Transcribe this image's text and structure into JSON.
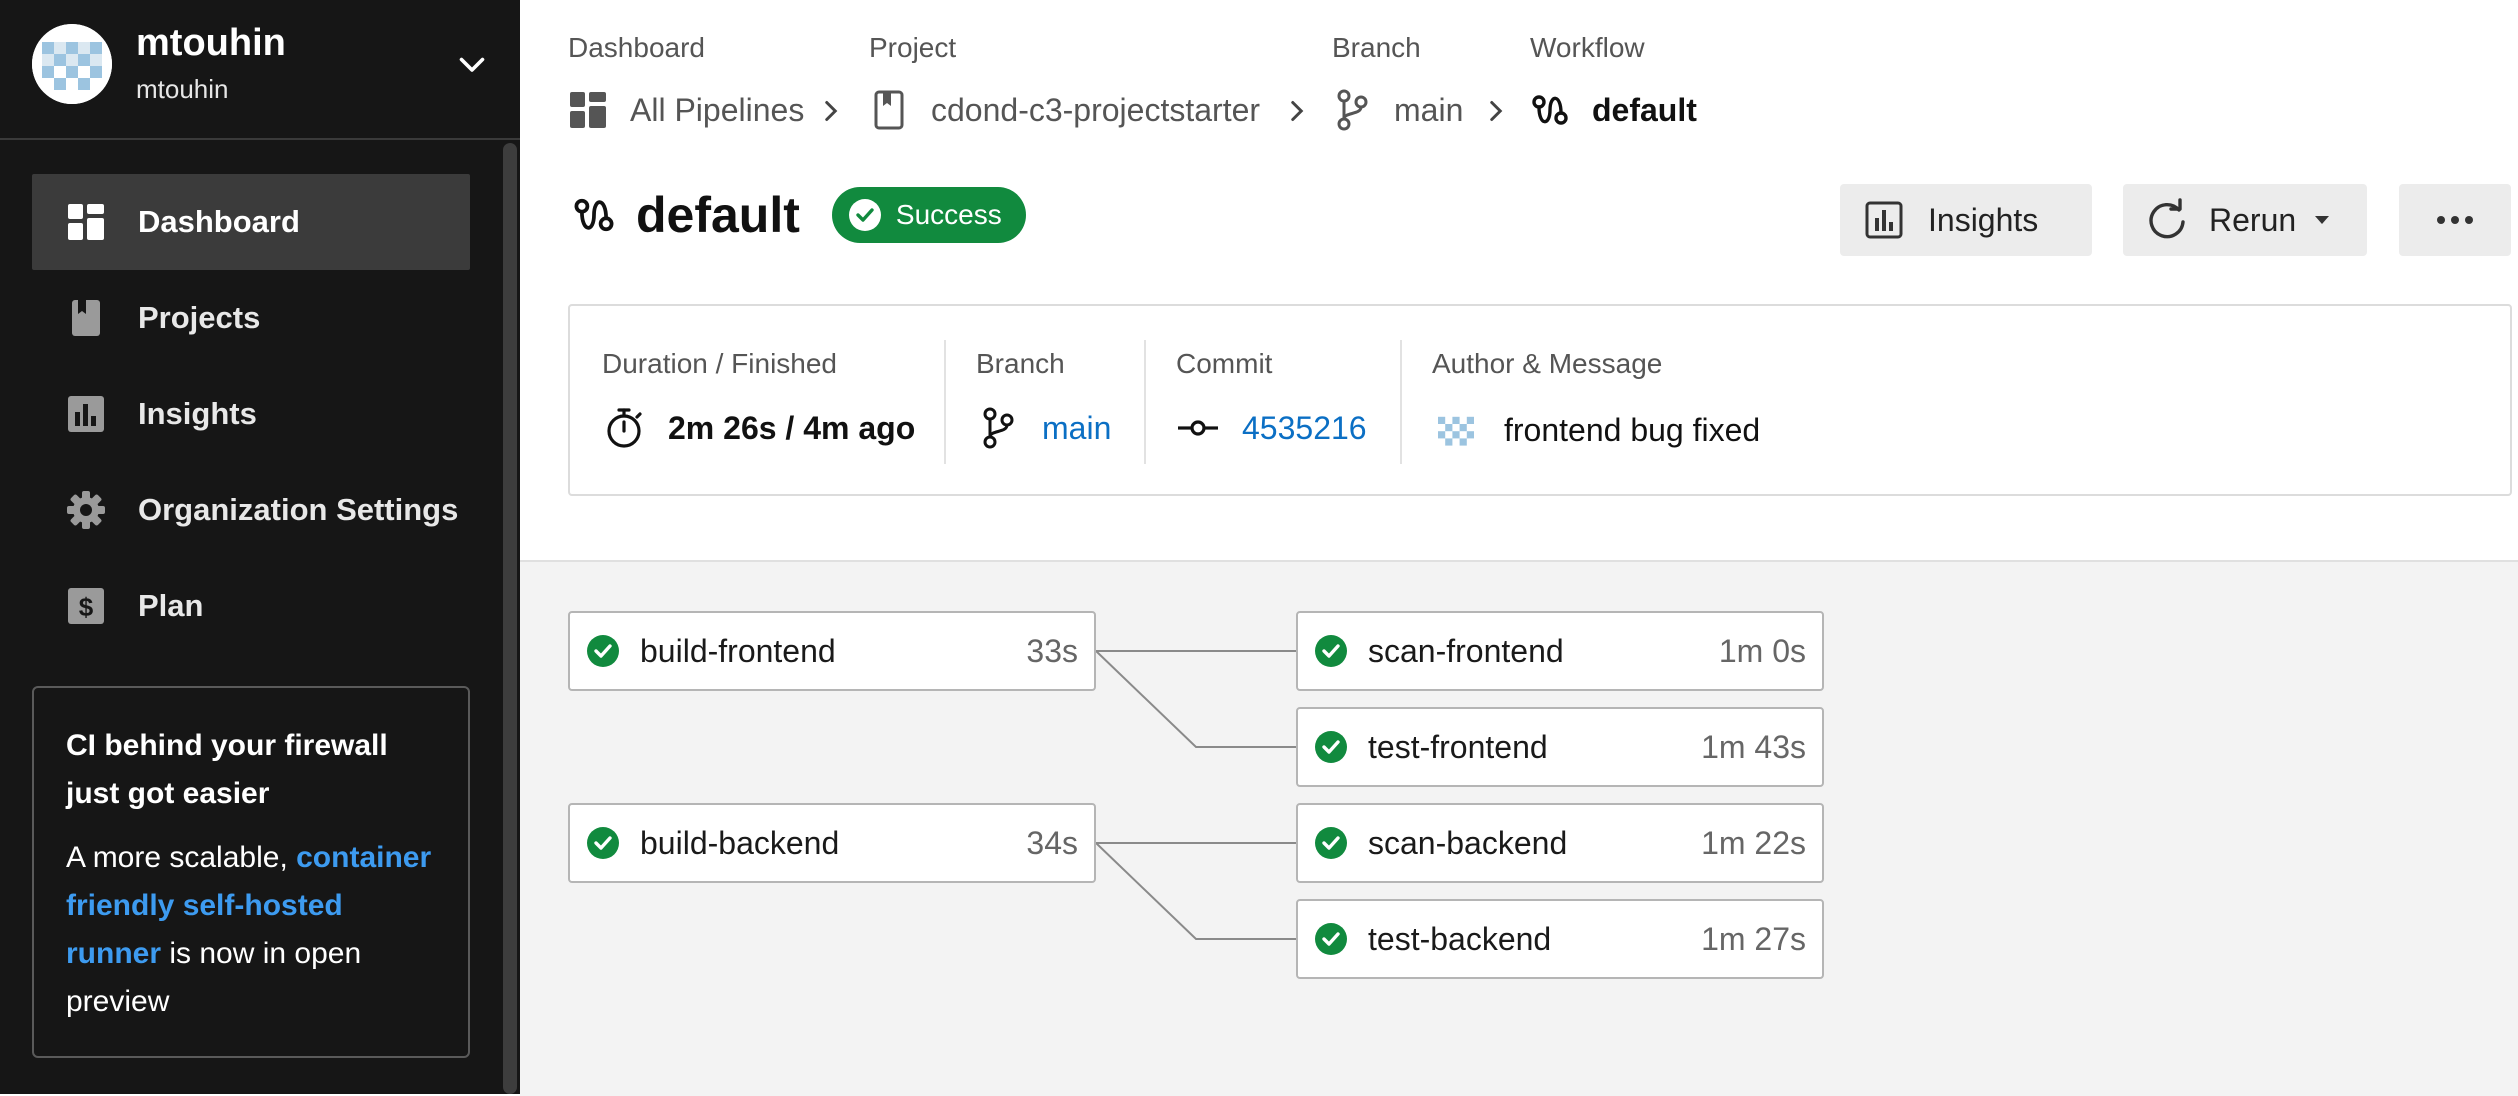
{
  "sidebar": {
    "org_name": "mtouhin",
    "org_sub": "mtouhin",
    "nav": [
      {
        "label": "Dashboard",
        "icon": "dashboard-icon",
        "active": true
      },
      {
        "label": "Projects",
        "icon": "bookmark-icon"
      },
      {
        "label": "Insights",
        "icon": "bar-chart-icon"
      },
      {
        "label": "Organization Settings",
        "icon": "gear-icon"
      },
      {
        "label": "Plan",
        "icon": "dollar-icon"
      }
    ],
    "promo": {
      "title": "CI behind your firewall just got easier",
      "text_before": "A more scalable, ",
      "link": "container friendly self-hosted runner",
      "text_after": " is now in open preview"
    }
  },
  "breadcrumb": {
    "dashboard_label": "Dashboard",
    "dashboard_value": "All Pipelines",
    "project_label": "Project",
    "project_value": "cdond-c3-projectstarter",
    "branch_label": "Branch",
    "branch_value": "main",
    "workflow_label": "Workflow",
    "workflow_value": "default"
  },
  "workflow": {
    "title": "default",
    "status": "Success",
    "status_color": "#118a3e"
  },
  "actions": {
    "insights": "Insights",
    "rerun": "Rerun"
  },
  "details": {
    "duration_label": "Duration / Finished",
    "duration_value": "2m 26s / 4m ago",
    "branch_label": "Branch",
    "branch_value": "main",
    "commit_label": "Commit",
    "commit_value": "4535216",
    "author_label": "Author & Message",
    "author_message": "frontend bug fixed"
  },
  "jobs": [
    {
      "name": "build-frontend",
      "duration": "33s"
    },
    {
      "name": "scan-frontend",
      "duration": "1m 0s"
    },
    {
      "name": "test-frontend",
      "duration": "1m 43s"
    },
    {
      "name": "build-backend",
      "duration": "34s"
    },
    {
      "name": "scan-backend",
      "duration": "1m 22s"
    },
    {
      "name": "test-backend",
      "duration": "1m 27s"
    }
  ],
  "colors": {
    "sidebar_bg": "#161616",
    "accent_link": "#0b6fc4",
    "promo_link": "#3d9bf0",
    "success": "#118a3e"
  }
}
